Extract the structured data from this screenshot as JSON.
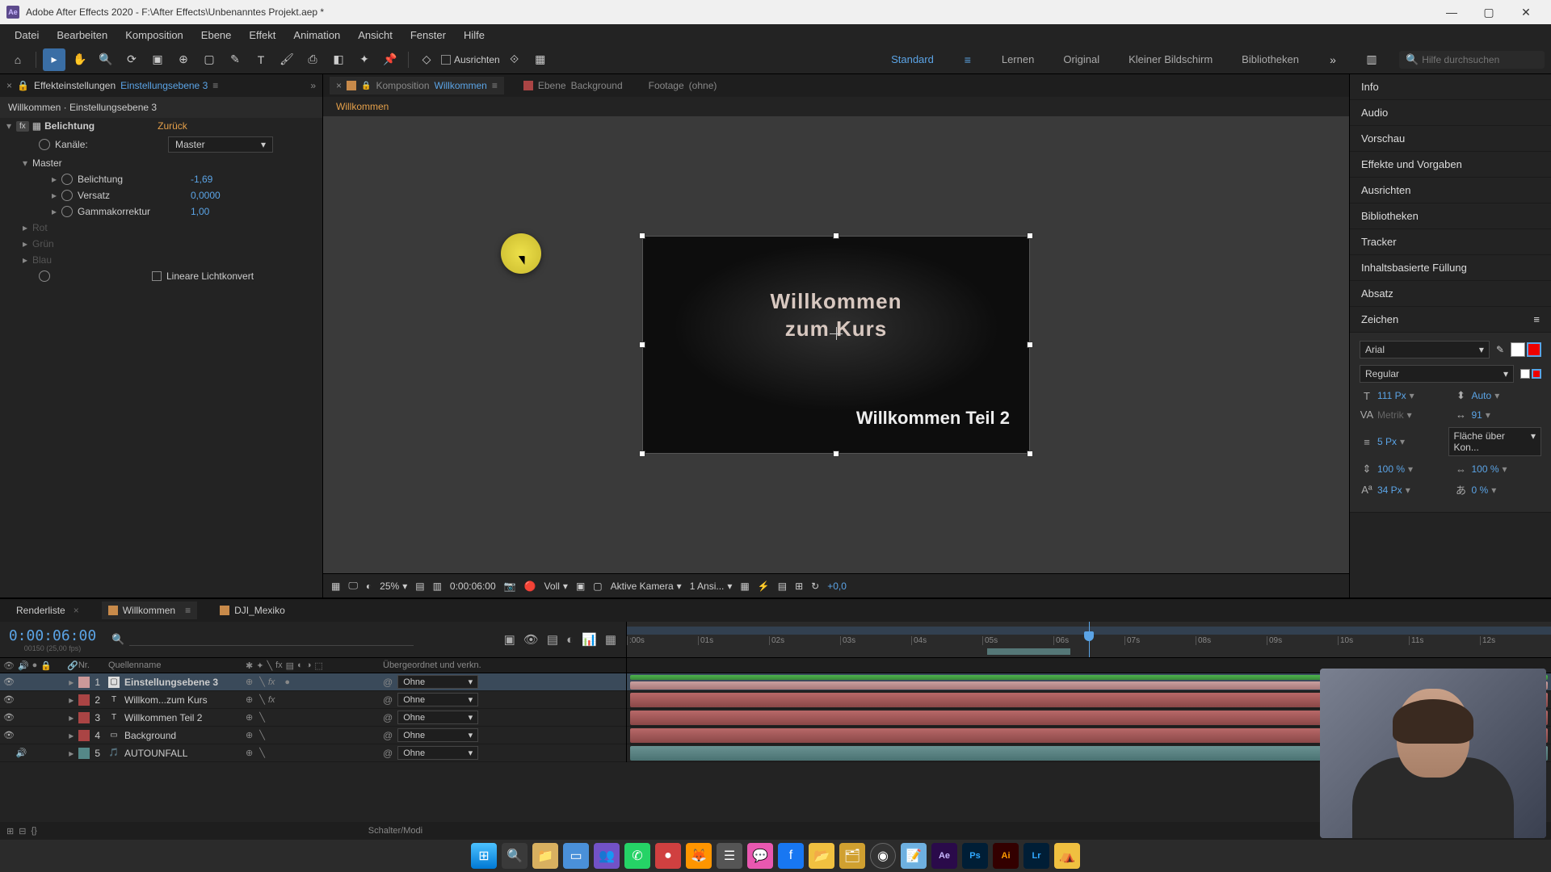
{
  "title": "Adobe After Effects 2020 - F:\\After Effects\\Unbenanntes Projekt.aep *",
  "menu": [
    "Datei",
    "Bearbeiten",
    "Komposition",
    "Ebene",
    "Effekt",
    "Animation",
    "Ansicht",
    "Fenster",
    "Hilfe"
  ],
  "toolbar": {
    "ausrichten": "Ausrichten"
  },
  "workspaces": {
    "standard": "Standard",
    "lernen": "Lernen",
    "original": "Original",
    "kleiner": "Kleiner Bildschirm",
    "bibliotheken": "Bibliotheken"
  },
  "search": {
    "placeholder": "Hilfe durchsuchen"
  },
  "effect_controls": {
    "tab_prefix": "Effekteinstellungen",
    "tab_link": "Einstellungsebene 3",
    "subtitle": "Willkommen · Einstellungsebene 3",
    "effect_name": "Belichtung",
    "reset": "Zurück",
    "channels_label": "Kanäle:",
    "channels_value": "Master",
    "master": "Master",
    "props": {
      "belichtung": {
        "label": "Belichtung",
        "value": "-1,69"
      },
      "versatz": {
        "label": "Versatz",
        "value": "0,0000"
      },
      "gamma": {
        "label": "Gammakorrektur",
        "value": "1,00"
      }
    },
    "disabled": {
      "rot": "Rot",
      "gruen": "Grün",
      "blau": "Blau"
    },
    "linear_light": "Lineare Lichtkonvert"
  },
  "comp_panel": {
    "tab_komp": {
      "prefix": "Komposition",
      "name": "Willkommen"
    },
    "tab_ebene": {
      "prefix": "Ebene",
      "name": "Background"
    },
    "tab_footage": {
      "prefix": "Footage",
      "name": "(ohne)"
    },
    "breadcrumb": "Willkommen",
    "text1_line1": "Willkommen",
    "text1_line2": "zum Kurs",
    "text2": "Willkommen Teil 2"
  },
  "viewer_footer": {
    "zoom": "25%",
    "timecode": "0:00:06:00",
    "resolution": "Voll",
    "camera": "Aktive Kamera",
    "views": "1 Ansi...",
    "exposure": "+0,0"
  },
  "right_panels": [
    "Info",
    "Audio",
    "Vorschau",
    "Effekte und Vorgaben",
    "Ausrichten",
    "Bibliotheken",
    "Tracker",
    "Inhaltsbasierte Füllung",
    "Absatz"
  ],
  "char_panel": {
    "title": "Zeichen",
    "font": "Arial",
    "style": "Regular",
    "size": "111 Px",
    "leading": "Auto",
    "kerning": "Metrik",
    "tracking": "91",
    "stroke_w": "5 Px",
    "stroke_mode": "Fläche über Kon...",
    "vscale": "100 %",
    "hscale": "100 %",
    "baseline": "34 Px",
    "tsume": "0 %"
  },
  "timeline": {
    "tabs": {
      "render": "Renderliste",
      "willkommen": "Willkommen",
      "dji": "DJI_Mexiko"
    },
    "timecode": "0:00:06:00",
    "fps": "00150 (25,00 fps)",
    "col_nr": "Nr.",
    "col_name": "Quellenname",
    "col_parent": "Übergeordnet und verkn.",
    "parent_none": "Ohne",
    "layers": [
      {
        "num": "1",
        "name": "Einstellungsebene 3",
        "type": "adj",
        "color": "pink",
        "selected": true,
        "fx": true
      },
      {
        "num": "2",
        "name": "Willkom...zum Kurs",
        "type": "txt",
        "color": "red",
        "fx": true
      },
      {
        "num": "3",
        "name": "Willkommen Teil 2",
        "type": "txt",
        "color": "red"
      },
      {
        "num": "4",
        "name": "Background",
        "type": "img",
        "color": "red"
      },
      {
        "num": "5",
        "name": "AUTOUNFALL",
        "type": "audio",
        "color": "teal"
      }
    ],
    "ruler": [
      ":00s",
      "01s",
      "02s",
      "03s",
      "04s",
      "05s",
      "06s",
      "07s",
      "08s",
      "09s",
      "10s",
      "11s",
      "12s"
    ],
    "footer_mode": "Schalter/Modi"
  }
}
